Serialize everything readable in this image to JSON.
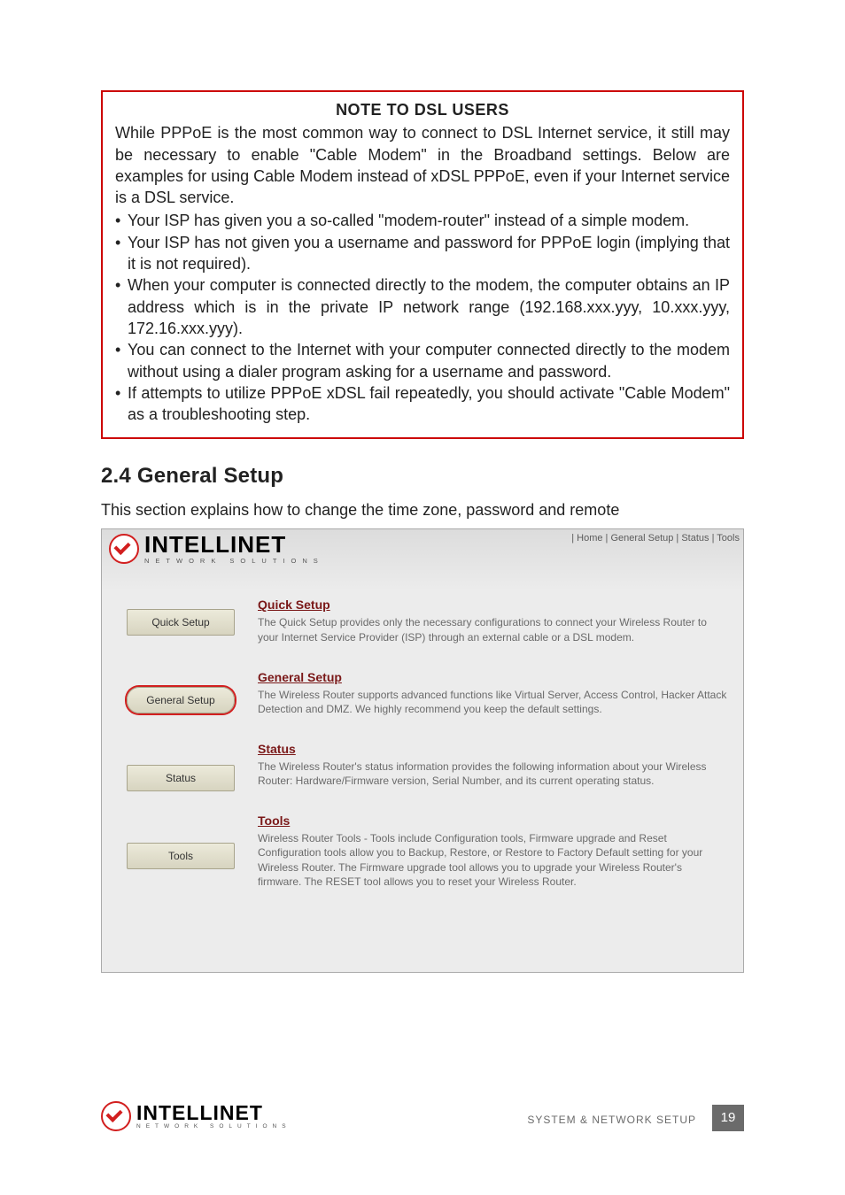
{
  "note": {
    "title": "NOTE TO DSL USERS",
    "intro": "While PPPoE is the most common way to connect to DSL Internet service, it still may be necessary to enable \"Cable Modem\" in the Broadband settings. Below are examples for using Cable Modem instead of xDSL PPPoE, even if your Internet service is a DSL service.",
    "bullets": [
      "Your ISP has given you a so-called \"modem-router\" instead of a simple modem.",
      "Your ISP has not given you a username and password for PPPoE login (implying that it is not required).",
      "When your computer is connected directly to the modem, the computer obtains an IP address which is in the private IP network range (192.168.xxx.yyy, 10.xxx.yyy, 172.16.xxx.yyy).",
      "You can connect to the Internet with your computer connected directly to the modem without using a dialer program asking for a username and password.",
      "If attempts to utilize PPPoE xDSL fail repeatedly, you should activate \"Cable Modem\" as a troubleshooting step."
    ]
  },
  "section": {
    "heading": "2.4  General Setup",
    "sub": "This section explains how to change the time zone, password and remote"
  },
  "router": {
    "brand_big": "INTELLINET",
    "brand_small": "NETWORK SOLUTIONS",
    "topnav": " | Home | General Setup | Status | Tools",
    "sidebar": [
      {
        "label": "Quick Setup",
        "highlight": false
      },
      {
        "label": "General Setup",
        "highlight": true
      },
      {
        "label": "Status",
        "highlight": false
      },
      {
        "label": "Tools",
        "highlight": false
      }
    ],
    "content": [
      {
        "title": "Quick Setup",
        "text": "The Quick Setup provides only the necessary configurations to connect your Wireless Router to your Internet Service Provider (ISP) through an external cable or a DSL modem."
      },
      {
        "title": "General Setup",
        "text": "The Wireless Router supports advanced functions like Virtual Server, Access Control, Hacker Attack Detection and DMZ. We highly recommend you keep the default settings."
      },
      {
        "title": "Status",
        "text": "The Wireless Router's status information provides the following information about your Wireless Router: Hardware/Firmware version, Serial Number, and its current operating status."
      },
      {
        "title": "Tools",
        "text": "Wireless Router Tools - Tools include Configuration tools, Firmware upgrade and Reset Configuration tools allow you to Backup, Restore, or Restore to Factory Default setting for your Wireless Router. The Firmware upgrade tool allows you to upgrade your Wireless Router's firmware. The RESET tool allows you to reset your Wireless Router."
      }
    ]
  },
  "footer": {
    "brand_big": "INTELLINET",
    "brand_small": "NETWORK SOLUTIONS",
    "section_label": "SYSTEM & NETWORK SETUP",
    "page_number": "19"
  }
}
